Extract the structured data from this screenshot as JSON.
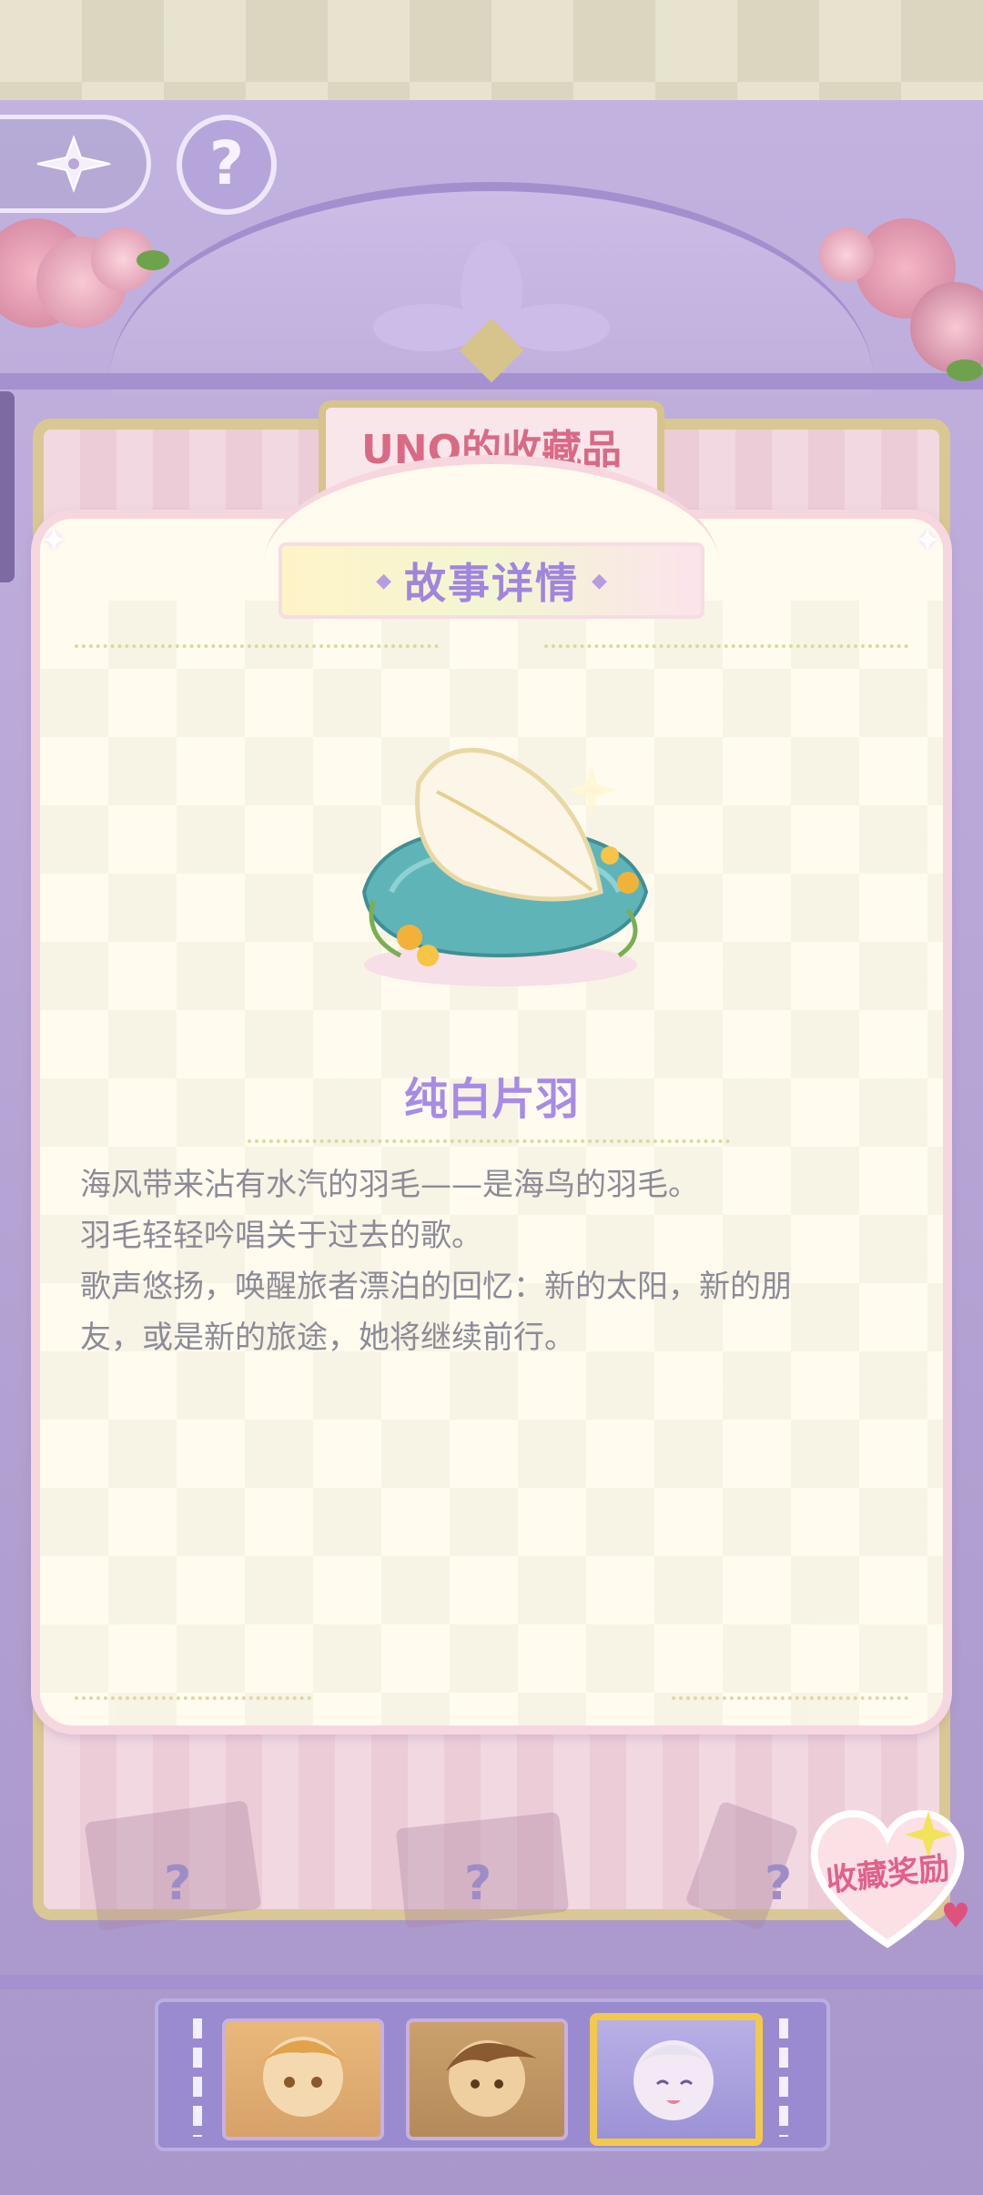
{
  "header": {
    "back_icon": "winged-star-back-icon",
    "help_label": "?"
  },
  "collection": {
    "owner_title": "UNO的收藏品"
  },
  "dialog": {
    "title": "故事详情",
    "item_name": "纯白片羽",
    "item_icon": "white-feather-on-pillow-icon",
    "story_lines": [
      "海风带来沾有水汽的羽毛——是海鸟的羽毛。",
      "羽毛轻轻吟唱关于过去的歌。",
      "歌声悠扬，唤醒旅者漂泊的回忆：新的太阳，新的朋",
      "友，或是新的旅途，她将继续前行。"
    ]
  },
  "reward": {
    "label": "收藏奖励"
  },
  "shelf": {
    "locked_marks": [
      "?",
      "?",
      "?"
    ]
  },
  "characters": {
    "selected_index": 2,
    "items": [
      {
        "name": "character-1-portrait"
      },
      {
        "name": "character-2-portrait"
      },
      {
        "name": "character-3-portrait"
      }
    ]
  },
  "colors": {
    "accent": "#a185dc",
    "title_pink": "#d96a86",
    "text_gray": "#8d8a98",
    "selected_border": "#f2c94c"
  }
}
